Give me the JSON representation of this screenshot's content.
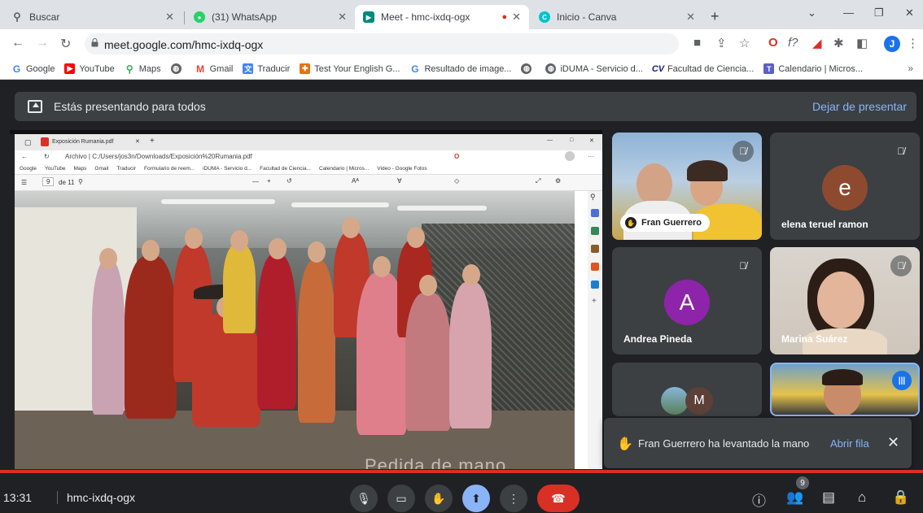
{
  "browser": {
    "tabs": [
      {
        "title": "Buscar"
      },
      {
        "title": "(31) WhatsApp",
        "badge": "31"
      },
      {
        "title": "Meet - hmc-ixdq-ogx"
      },
      {
        "title": "Inicio - Canva"
      }
    ],
    "url": "meet.google.com/hmc-ixdq-ogx",
    "profile_initial": "J",
    "bookmarks": [
      "Google",
      "YouTube",
      "Maps",
      "Gmail",
      "Traducir",
      "Test Your English G...",
      "Resultado de image...",
      "iDUMA - Servicio d...",
      "Facultad de Ciencia...",
      "Calendario | Micros..."
    ],
    "more_bookmarks": "»"
  },
  "meet": {
    "presenting_text": "Estás presentando para todos",
    "stop_presenting": "Dejar de presentar",
    "shared_window": {
      "tab_title": "Exposición Rumania.pdf",
      "file_path": "Archivo | C:/Users/jos3n/Downloads/Exposición%20Rumania.pdf",
      "bookmarks": [
        "Google",
        "YouTube",
        "Maps",
        "Gmail",
        "Traducir",
        "Formulario de reem...",
        "iDUMA - Servicio d...",
        "Facultad de Ciencia...",
        "Calendario | Micros...",
        "Video - Google Fotos"
      ],
      "page_current": "9",
      "page_total": "de 11",
      "slide_caption": "Pedida de mano"
    },
    "participants": [
      {
        "name": "Fran Guerrero",
        "raised_hand": true,
        "muted": true
      },
      {
        "name": "elena teruel ramon",
        "initial": "e",
        "color": "#8d4a2f",
        "muted": true
      },
      {
        "name": "Andrea Pineda",
        "initial": "A",
        "color": "#8e24aa",
        "muted": true
      },
      {
        "name": "Marina Suárez",
        "muted": true
      },
      {
        "name": "",
        "initial": "M",
        "color": "#5d4037"
      },
      {
        "name": "",
        "speaking": true
      }
    ],
    "toast": {
      "message": "Fran Guerrero ha levantado la mano",
      "action": "Abrir fila"
    },
    "bottom": {
      "time": "13:31",
      "meeting_code": "hmc-ixdq-ogx",
      "people_count": "9"
    }
  },
  "colors": {
    "meet_bg": "#202124",
    "accent": "#8ab4f8",
    "end_call": "#d93025"
  }
}
